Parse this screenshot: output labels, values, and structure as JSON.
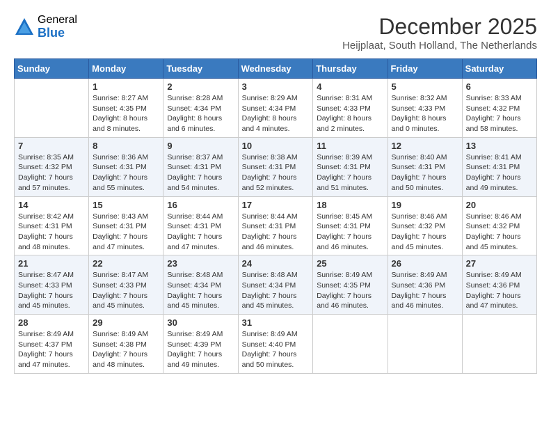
{
  "logo": {
    "general": "General",
    "blue": "Blue"
  },
  "title": {
    "month_year": "December 2025",
    "location": "Heijplaat, South Holland, The Netherlands"
  },
  "calendar": {
    "headers": [
      "Sunday",
      "Monday",
      "Tuesday",
      "Wednesday",
      "Thursday",
      "Friday",
      "Saturday"
    ],
    "weeks": [
      [
        {
          "day": "",
          "info": ""
        },
        {
          "day": "1",
          "info": "Sunrise: 8:27 AM\nSunset: 4:35 PM\nDaylight: 8 hours\nand 8 minutes."
        },
        {
          "day": "2",
          "info": "Sunrise: 8:28 AM\nSunset: 4:34 PM\nDaylight: 8 hours\nand 6 minutes."
        },
        {
          "day": "3",
          "info": "Sunrise: 8:29 AM\nSunset: 4:34 PM\nDaylight: 8 hours\nand 4 minutes."
        },
        {
          "day": "4",
          "info": "Sunrise: 8:31 AM\nSunset: 4:33 PM\nDaylight: 8 hours\nand 2 minutes."
        },
        {
          "day": "5",
          "info": "Sunrise: 8:32 AM\nSunset: 4:33 PM\nDaylight: 8 hours\nand 0 minutes."
        },
        {
          "day": "6",
          "info": "Sunrise: 8:33 AM\nSunset: 4:32 PM\nDaylight: 7 hours\nand 58 minutes."
        }
      ],
      [
        {
          "day": "7",
          "info": "Sunrise: 8:35 AM\nSunset: 4:32 PM\nDaylight: 7 hours\nand 57 minutes."
        },
        {
          "day": "8",
          "info": "Sunrise: 8:36 AM\nSunset: 4:31 PM\nDaylight: 7 hours\nand 55 minutes."
        },
        {
          "day": "9",
          "info": "Sunrise: 8:37 AM\nSunset: 4:31 PM\nDaylight: 7 hours\nand 54 minutes."
        },
        {
          "day": "10",
          "info": "Sunrise: 8:38 AM\nSunset: 4:31 PM\nDaylight: 7 hours\nand 52 minutes."
        },
        {
          "day": "11",
          "info": "Sunrise: 8:39 AM\nSunset: 4:31 PM\nDaylight: 7 hours\nand 51 minutes."
        },
        {
          "day": "12",
          "info": "Sunrise: 8:40 AM\nSunset: 4:31 PM\nDaylight: 7 hours\nand 50 minutes."
        },
        {
          "day": "13",
          "info": "Sunrise: 8:41 AM\nSunset: 4:31 PM\nDaylight: 7 hours\nand 49 minutes."
        }
      ],
      [
        {
          "day": "14",
          "info": "Sunrise: 8:42 AM\nSunset: 4:31 PM\nDaylight: 7 hours\nand 48 minutes."
        },
        {
          "day": "15",
          "info": "Sunrise: 8:43 AM\nSunset: 4:31 PM\nDaylight: 7 hours\nand 47 minutes."
        },
        {
          "day": "16",
          "info": "Sunrise: 8:44 AM\nSunset: 4:31 PM\nDaylight: 7 hours\nand 47 minutes."
        },
        {
          "day": "17",
          "info": "Sunrise: 8:44 AM\nSunset: 4:31 PM\nDaylight: 7 hours\nand 46 minutes."
        },
        {
          "day": "18",
          "info": "Sunrise: 8:45 AM\nSunset: 4:31 PM\nDaylight: 7 hours\nand 46 minutes."
        },
        {
          "day": "19",
          "info": "Sunrise: 8:46 AM\nSunset: 4:32 PM\nDaylight: 7 hours\nand 45 minutes."
        },
        {
          "day": "20",
          "info": "Sunrise: 8:46 AM\nSunset: 4:32 PM\nDaylight: 7 hours\nand 45 minutes."
        }
      ],
      [
        {
          "day": "21",
          "info": "Sunrise: 8:47 AM\nSunset: 4:33 PM\nDaylight: 7 hours\nand 45 minutes."
        },
        {
          "day": "22",
          "info": "Sunrise: 8:47 AM\nSunset: 4:33 PM\nDaylight: 7 hours\nand 45 minutes."
        },
        {
          "day": "23",
          "info": "Sunrise: 8:48 AM\nSunset: 4:34 PM\nDaylight: 7 hours\nand 45 minutes."
        },
        {
          "day": "24",
          "info": "Sunrise: 8:48 AM\nSunset: 4:34 PM\nDaylight: 7 hours\nand 45 minutes."
        },
        {
          "day": "25",
          "info": "Sunrise: 8:49 AM\nSunset: 4:35 PM\nDaylight: 7 hours\nand 46 minutes."
        },
        {
          "day": "26",
          "info": "Sunrise: 8:49 AM\nSunset: 4:36 PM\nDaylight: 7 hours\nand 46 minutes."
        },
        {
          "day": "27",
          "info": "Sunrise: 8:49 AM\nSunset: 4:36 PM\nDaylight: 7 hours\nand 47 minutes."
        }
      ],
      [
        {
          "day": "28",
          "info": "Sunrise: 8:49 AM\nSunset: 4:37 PM\nDaylight: 7 hours\nand 47 minutes."
        },
        {
          "day": "29",
          "info": "Sunrise: 8:49 AM\nSunset: 4:38 PM\nDaylight: 7 hours\nand 48 minutes."
        },
        {
          "day": "30",
          "info": "Sunrise: 8:49 AM\nSunset: 4:39 PM\nDaylight: 7 hours\nand 49 minutes."
        },
        {
          "day": "31",
          "info": "Sunrise: 8:49 AM\nSunset: 4:40 PM\nDaylight: 7 hours\nand 50 minutes."
        },
        {
          "day": "",
          "info": ""
        },
        {
          "day": "",
          "info": ""
        },
        {
          "day": "",
          "info": ""
        }
      ]
    ]
  }
}
